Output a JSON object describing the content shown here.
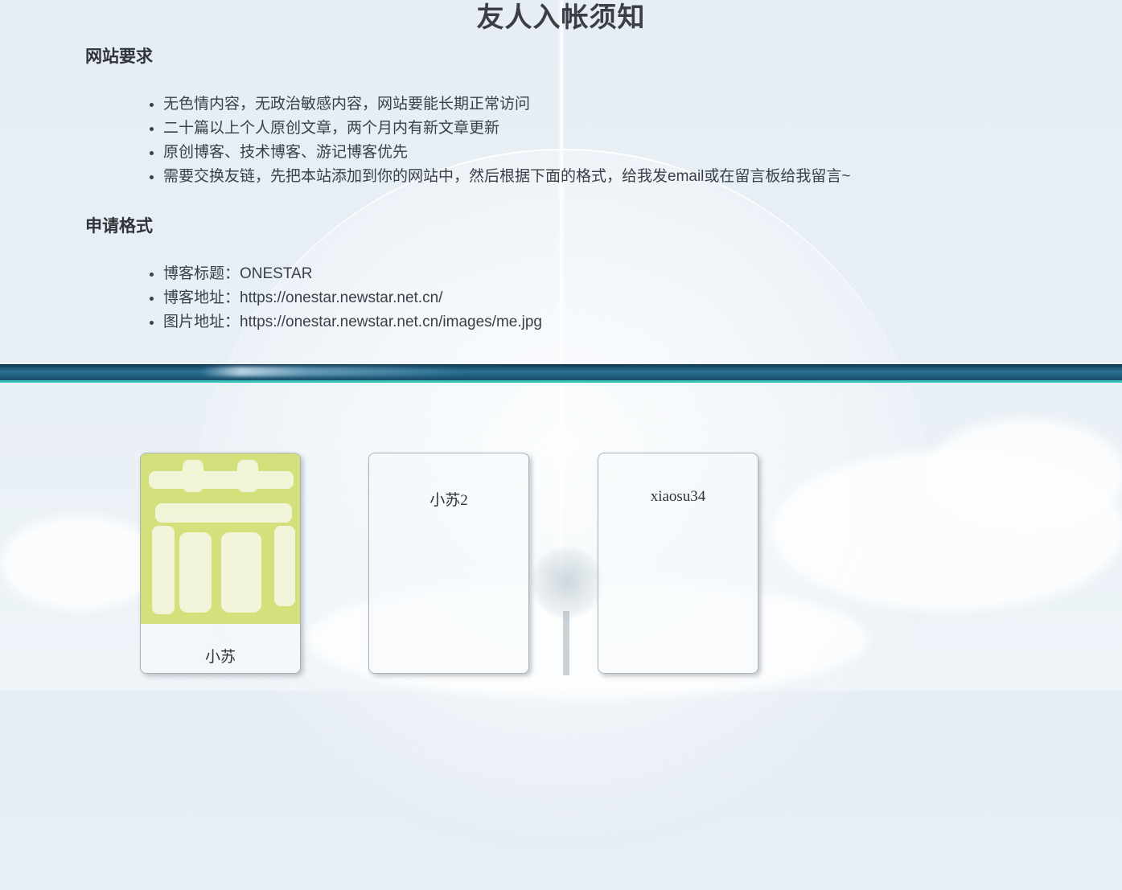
{
  "page": {
    "title": "友人入帐须知"
  },
  "requirements": {
    "heading": "网站要求",
    "items": [
      "无色情内容，无政治敏感内容，网站要能长期正常访问",
      "二十篇以上个人原创文章，两个月内有新文章更新",
      "原创博客、技术博客、游记博客优先",
      "需要交换友链，先把本站添加到你的网站中，然后根据下面的格式，给我发email或在留言板给我留言~"
    ]
  },
  "format": {
    "heading": "申请格式",
    "items": [
      "博客标题：ONESTAR",
      "博客地址：https://onestar.newstar.net.cn/",
      "图片地址：https://onestar.newstar.net.cn/images/me.jpg"
    ]
  },
  "friends": [
    {
      "name": "小苏",
      "avatar_glyph": "苏",
      "avatar_color": "#d3e07c"
    },
    {
      "name": "小苏2"
    },
    {
      "name": "xiaosu34"
    }
  ],
  "colors": {
    "divider_dark": "#0c3550",
    "divider_accent": "#34c2b5"
  }
}
